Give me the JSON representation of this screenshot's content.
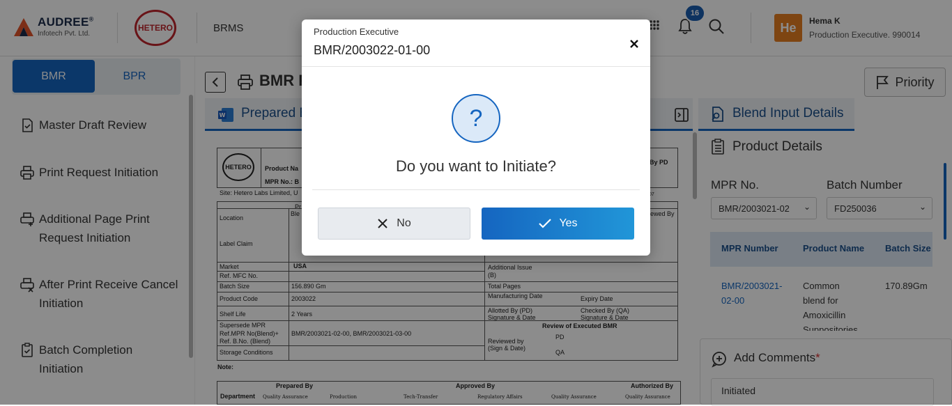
{
  "header": {
    "brand_name": "AUDREE",
    "brand_reg": "®",
    "brand_sub": "Infotech Pvt. Ltd.",
    "client_logo": "HETERO",
    "app_name": "BRMS",
    "notification_count": "16",
    "user_initials": "He",
    "user_name": "Hema K",
    "user_role": "Production Executive. 990014"
  },
  "sidebar": {
    "tabs": [
      {
        "label": "BMR"
      },
      {
        "label": "BPR"
      }
    ],
    "items": [
      {
        "label": "Master Draft Review"
      },
      {
        "label": "Print Request Initiation"
      },
      {
        "label": "Additional Page Print Request Initiation"
      },
      {
        "label": "After Print Receive Cancel Initiation"
      },
      {
        "label": "Batch Completion Initiation"
      }
    ]
  },
  "main": {
    "page_title": "BMR P",
    "sub_tab": "Prepared B",
    "document": {
      "logo": "HETERO",
      "product_name_label": "Product Na",
      "mpr_no_label": "MPR No.: B",
      "by_pd": "By PD",
      "site": "Site: Hetero Labs Limited, U",
      "code": "07",
      "pr": "Pr",
      "bl": "Ble",
      "viewed_by": "iewed By",
      "rows": [
        {
          "label": "Location",
          "value": ""
        },
        {
          "label": "Label Claim",
          "value": ""
        },
        {
          "label": "Market",
          "value": "USA"
        },
        {
          "label": "Ref. MFC No.",
          "value": ""
        },
        {
          "label": "Batch Size",
          "value": "156.890 Gm"
        },
        {
          "label": "Product Code",
          "value": "2003022"
        },
        {
          "label": "Shelf Life",
          "value": "2 Years"
        },
        {
          "label": "Supersede MPR",
          "value": ""
        },
        {
          "label": "Ref.MPR No(Blend)+",
          "value": "BMR/2003021-02-00, BMR/2003021-03-00"
        },
        {
          "label": "Ref. B.No. (Blend)",
          "value": ""
        },
        {
          "label": "Storage Conditions",
          "value": ""
        }
      ],
      "right_rows": {
        "additional_issue": "Additional Issue (B)",
        "total_pages": "Total Pages",
        "manufacturing_date": "Manufacturing Date",
        "expiry_date": "Expiry Date",
        "allotted_by": "Allotted By (PD) Signature & Date",
        "checked_by": "Checked By (QA) Signature & Date",
        "review_header": "Review of Executed BMR",
        "reviewed_by": "Reviewed by (Sign & Date)",
        "pd": "PD",
        "qa": "QA"
      },
      "note": "Note:",
      "approval": {
        "prepared_by": "Prepared By",
        "approved_by": "Approved By",
        "authorized_by": "Authorized By",
        "department": "Department",
        "depts": [
          "Quality Assurance",
          "Production",
          "Tech-Transfer",
          "Regulatory Affairs",
          "Quality Assurance",
          "Quality Assurance"
        ]
      }
    }
  },
  "right_panel": {
    "priority_label": "Priority",
    "blend_tab": "Blend Input Details",
    "product_details": "Product Details",
    "mpr_label": "MPR No.",
    "mpr_value": "BMR/2003021-02",
    "batch_label": "Batch Number",
    "batch_value": "FD250036",
    "table": {
      "headers": [
        "MPR Number",
        "Product Name",
        "Batch Size"
      ],
      "row": {
        "mpr": "BMR/2003021-02-00",
        "mpr_l1": "BMR/2003021-",
        "mpr_l2": "02-00",
        "name_l1": "Common",
        "name_l2": "blend for",
        "name_l3": "Amoxicillin",
        "name_l4": "Suppositories",
        "size": "170.89Gm"
      }
    },
    "comments_label": "Add Comments",
    "comments_required": "*",
    "comments_value": "Initiated"
  },
  "modal": {
    "subtitle": "Production Executive",
    "title": "BMR/2003022-01-00",
    "icon": "?",
    "message": "Do you want to Initiate?",
    "no_label": "No",
    "yes_label": "Yes"
  },
  "colors": {
    "primary": "#1565c0",
    "accent": "#e67e22",
    "brand_red": "#c0262d"
  }
}
